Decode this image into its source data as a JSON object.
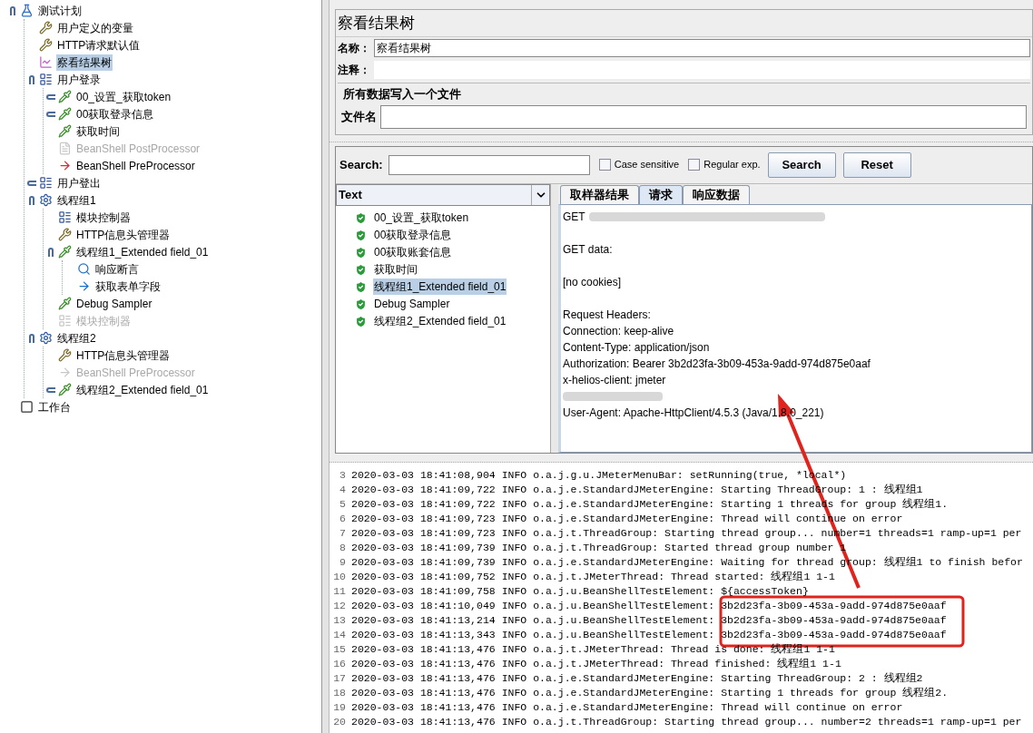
{
  "tree": [
    {
      "label": "测试计划",
      "kind": "plan",
      "selected": false,
      "disabled": false,
      "expanded": true,
      "children": [
        {
          "label": "用户定义的变量",
          "kind": "config",
          "selected": false,
          "disabled": false
        },
        {
          "label": "HTTP请求默认值",
          "kind": "config",
          "selected": false,
          "disabled": false
        },
        {
          "label": "察看结果树",
          "kind": "listener",
          "selected": true,
          "disabled": false
        },
        {
          "label": "用户登录",
          "kind": "controller",
          "selected": false,
          "disabled": false,
          "expanded": true,
          "children": [
            {
              "label": "00_设置_获取token",
              "kind": "sampler",
              "selected": false,
              "disabled": false,
              "expanded": false
            },
            {
              "label": "00获取登录信息",
              "kind": "sampler",
              "selected": false,
              "disabled": false,
              "expanded": false
            },
            {
              "label": "获取时间",
              "kind": "sampler",
              "selected": false,
              "disabled": false
            },
            {
              "label": "BeanShell PostProcessor",
              "kind": "postprocessor",
              "selected": false,
              "disabled": true
            },
            {
              "label": "BeanShell PreProcessor",
              "kind": "preprocessor",
              "selected": false,
              "disabled": false
            }
          ]
        },
        {
          "label": "用户登出",
          "kind": "controller",
          "selected": false,
          "disabled": false,
          "expanded": false
        },
        {
          "label": "线程组1",
          "kind": "threadgroup",
          "selected": false,
          "disabled": false,
          "expanded": true,
          "children": [
            {
              "label": "模块控制器",
              "kind": "controller",
              "selected": false,
              "disabled": false
            },
            {
              "label": "HTTP信息头管理器",
              "kind": "config",
              "selected": false,
              "disabled": false
            },
            {
              "label": "线程组1_Extended field_01",
              "kind": "sampler",
              "selected": false,
              "disabled": false,
              "expanded": true,
              "children": [
                {
                  "label": "响应断言",
                  "kind": "assertion",
                  "selected": false,
                  "disabled": false
                },
                {
                  "label": "获取表单字段",
                  "kind": "extractor",
                  "selected": false,
                  "disabled": false
                }
              ]
            },
            {
              "label": "Debug Sampler",
              "kind": "sampler",
              "selected": false,
              "disabled": false
            },
            {
              "label": "模块控制器",
              "kind": "controller",
              "selected": false,
              "disabled": true
            }
          ]
        },
        {
          "label": "线程组2",
          "kind": "threadgroup",
          "selected": false,
          "disabled": false,
          "expanded": true,
          "children": [
            {
              "label": "HTTP信息头管理器",
              "kind": "config",
              "selected": false,
              "disabled": false
            },
            {
              "label": "BeanShell PreProcessor",
              "kind": "preprocessor",
              "selected": false,
              "disabled": true
            },
            {
              "label": "线程组2_Extended field_01",
              "kind": "sampler",
              "selected": false,
              "disabled": false,
              "expanded": false
            }
          ]
        }
      ]
    },
    {
      "label": "工作台",
      "kind": "workbench",
      "selected": false,
      "disabled": false
    }
  ],
  "panel": {
    "title": "察看结果树",
    "name_field": {
      "label": "名称：",
      "value": "察看结果树"
    },
    "comment_field": {
      "label": "注释："
    },
    "file_section": {
      "legend": "所有数据写入一个文件",
      "label": "文件名"
    },
    "search": {
      "label": "Search:",
      "options": [
        {
          "label": "Case sensitive",
          "checked": false
        },
        {
          "label": "Regular exp.",
          "checked": false
        }
      ],
      "buttons": [
        "Search",
        "Reset"
      ]
    },
    "renderer": "Text",
    "samples": [
      {
        "label": "00_设置_获取token",
        "selected": false
      },
      {
        "label": "00获取登录信息",
        "selected": false
      },
      {
        "label": "00获取账套信息",
        "selected": false
      },
      {
        "label": "获取时间",
        "selected": false
      },
      {
        "label": "线程组1_Extended field_01",
        "selected": true
      },
      {
        "label": "Debug Sampler",
        "selected": false
      },
      {
        "label": "线程组2_Extended field_01",
        "selected": false
      }
    ],
    "tabs": [
      {
        "label": "取样器结果",
        "selected": false
      },
      {
        "label": "请求",
        "selected": true
      },
      {
        "label": "响应数据",
        "selected": false
      }
    ],
    "request": [
      [
        {
          "text": "GET",
          "kind": "partly_blurred"
        }
      ],
      [
        {
          "text": "GET data:",
          "kind": "text"
        }
      ],
      [
        {
          "text": "[no cookies]",
          "kind": "text"
        }
      ],
      [
        {
          "text": "Request Headers:",
          "kind": "text"
        },
        {
          "text": "Connection: keep-alive",
          "kind": "text"
        },
        {
          "text": "Content-Type: application/json",
          "kind": "text"
        },
        {
          "text": "Authorization: Bearer 3b2d23fa-3b09-453a-9add-974d875e0aaf",
          "kind": "text"
        },
        {
          "text": "x-helios-client: jmeter",
          "kind": "text"
        },
        {
          "kind": "blurred"
        },
        {
          "text": "User-Agent: Apache-HttpClient/4.5.3 (Java/1.8.0_221)",
          "kind": "text"
        }
      ]
    ]
  },
  "log": [
    {
      "number": "3",
      "text": "2020-03-03 18:41:08,904 INFO o.a.j.g.u.JMeterMenuBar: setRunning(true, *local*)"
    },
    {
      "number": "4",
      "text": "2020-03-03 18:41:09,722 INFO o.a.j.e.StandardJMeterEngine: Starting ThreadGroup: 1 : 线程组1"
    },
    {
      "number": "5",
      "text": "2020-03-03 18:41:09,722 INFO o.a.j.e.StandardJMeterEngine: Starting 1 threads for group 线程组1."
    },
    {
      "number": "6",
      "text": "2020-03-03 18:41:09,723 INFO o.a.j.e.StandardJMeterEngine: Thread will continue on error"
    },
    {
      "number": "7",
      "text": "2020-03-03 18:41:09,723 INFO o.a.j.t.ThreadGroup: Starting thread group... number=1 threads=1 ramp-up=1 per"
    },
    {
      "number": "8",
      "text": "2020-03-03 18:41:09,739 INFO o.a.j.t.ThreadGroup: Started thread group number 1"
    },
    {
      "number": "9",
      "text": "2020-03-03 18:41:09,739 INFO o.a.j.e.StandardJMeterEngine: Waiting for thread group: 线程组1 to finish befor"
    },
    {
      "number": "10",
      "text": "2020-03-03 18:41:09,752 INFO o.a.j.t.JMeterThread: Thread started: 线程组1 1-1"
    },
    {
      "number": "11",
      "text": "2020-03-03 18:41:09,758 INFO o.a.j.u.BeanShellTestElement: ${accessToken}"
    },
    {
      "number": "12",
      "text": "2020-03-03 18:41:10,049 INFO o.a.j.u.BeanShellTestElement: 3b2d23fa-3b09-453a-9add-974d875e0aaf"
    },
    {
      "number": "13",
      "text": "2020-03-03 18:41:13,214 INFO o.a.j.u.BeanShellTestElement: 3b2d23fa-3b09-453a-9add-974d875e0aaf"
    },
    {
      "number": "14",
      "text": "2020-03-03 18:41:13,343 INFO o.a.j.u.BeanShellTestElement: 3b2d23fa-3b09-453a-9add-974d875e0aaf"
    },
    {
      "number": "15",
      "text": "2020-03-03 18:41:13,476 INFO o.a.j.t.JMeterThread: Thread is done: 线程组1 1-1"
    },
    {
      "number": "16",
      "text": "2020-03-03 18:41:13,476 INFO o.a.j.t.JMeterThread: Thread finished: 线程组1 1-1"
    },
    {
      "number": "17",
      "text": "2020-03-03 18:41:13,476 INFO o.a.j.e.StandardJMeterEngine: Starting ThreadGroup: 2 : 线程组2"
    },
    {
      "number": "18",
      "text": "2020-03-03 18:41:13,476 INFO o.a.j.e.StandardJMeterEngine: Starting 1 threads for group 线程组2."
    },
    {
      "number": "19",
      "text": "2020-03-03 18:41:13,476 INFO o.a.j.e.StandardJMeterEngine: Thread will continue on error"
    },
    {
      "number": "20",
      "text": "2020-03-03 18:41:13,476 INFO o.a.j.t.ThreadGroup: Starting thread group... number=2 threads=1 ramp-up=1 per"
    }
  ]
}
